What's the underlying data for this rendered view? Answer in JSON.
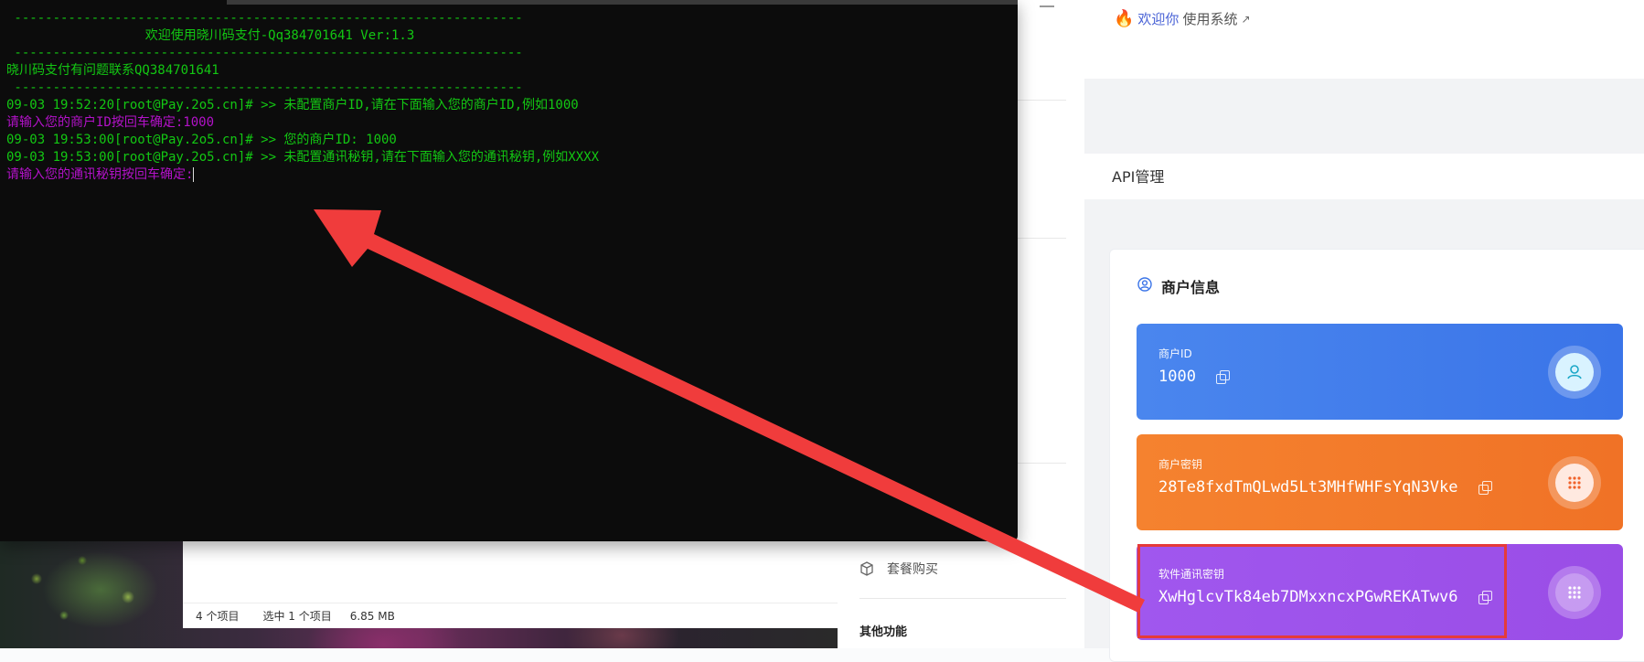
{
  "terminal": {
    "lines": [
      {
        "text": " ------------------------------------------------------------------",
        "color": "green"
      },
      {
        "text": "                  欢迎使用晓川码支付-Qq384701641 Ver:1.3",
        "color": "green"
      },
      {
        "text": " ------------------------------------------------------------------",
        "color": "green"
      },
      {
        "text": "晓川码支付有问题联系QQ384701641",
        "color": "green"
      },
      {
        "text": " ------------------------------------------------------------------",
        "color": "green"
      },
      {
        "text": "09-03 19:52:20[root@Pay.2o5.cn]# >> 未配置商户ID,请在下面输入您的商户ID,例如1000",
        "color": "green"
      },
      {
        "text": "请输入您的商户ID按回车确定:1000",
        "color": "magenta"
      },
      {
        "text": "09-03 19:53:00[root@Pay.2o5.cn]# >> 您的商户ID: 1000",
        "color": "green"
      },
      {
        "text": "09-03 19:53:00[root@Pay.2o5.cn]# >> 未配置通讯秘钥,请在下面输入您的通讯秘钥,例如XXXX",
        "color": "green"
      },
      {
        "text": "请输入您的通讯秘钥按回车确定:",
        "color": "magenta"
      }
    ]
  },
  "explorer": {
    "item_count": "4 个项目",
    "selected": "选中 1 个项目",
    "size": "6.85 MB"
  },
  "sidebar": {
    "package_purchase": "套餐购买",
    "other_functions": "其他功能"
  },
  "header": {
    "welcome_prefix": "欢迎你",
    "welcome_suffix": "使用系统",
    "ext_icon": "↗"
  },
  "page": {
    "title": "API管理"
  },
  "merchant": {
    "title": "商户信息",
    "id_label": "商户ID",
    "id_value": "1000",
    "key_label": "商户密钥",
    "key_value": "28Te8fxdTmQLwd5Lt3MHfWHFsYqN3Vke",
    "soft_key_label": "软件通讯密钥",
    "soft_key_value": "XwHglcvTk84eb7DMxxncxPGwREKATwv6"
  },
  "colors": {
    "terminal_green": "#13c713",
    "terminal_magenta": "#b312c9",
    "blue_card": "#4a86ee",
    "orange_card": "#f5822f",
    "purple_card": "#a057ee",
    "arrow": "#f03c3c"
  }
}
